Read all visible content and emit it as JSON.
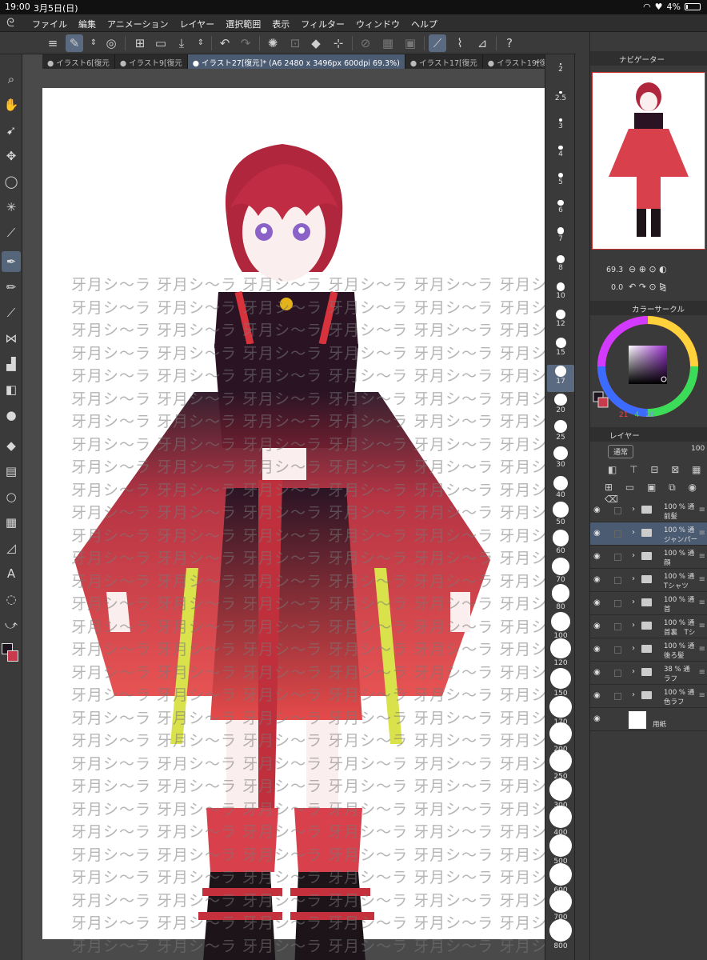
{
  "status": {
    "time": "19:00",
    "date": "3月5日(日)",
    "battery": "4%"
  },
  "menu": {
    "items": [
      "ファイル",
      "編集",
      "アニメーション",
      "レイヤー",
      "選択範囲",
      "表示",
      "フィルター",
      "ウィンドウ",
      "ヘルプ"
    ]
  },
  "tabs": [
    {
      "label": "● イラスト6[復元"
    },
    {
      "label": "● イラスト9[復元"
    },
    {
      "label": "● イラスト27[復元]* (A6 2480 x 3496px 600dpi 69.3%)"
    },
    {
      "label": "● イラスト17[復元"
    },
    {
      "label": "● イラスト19[復元"
    }
  ],
  "watermark": {
    "text": "牙月シ〜ラ"
  },
  "brush_sizes": [
    "2",
    "2.5",
    "3",
    "4",
    "5",
    "6",
    "7",
    "8",
    "10",
    "12",
    "15",
    "17",
    "20",
    "25",
    "30",
    "40",
    "50",
    "60",
    "70",
    "80",
    "100",
    "120",
    "150",
    "170",
    "200",
    "250",
    "300",
    "400",
    "500",
    "600",
    "700",
    "800"
  ],
  "navigator": {
    "title": "ナビゲーター",
    "zoom": "69.3",
    "rotation": "0.0"
  },
  "color": {
    "title": "カラーサークル",
    "r": "21",
    "g": "4",
    "b": "26"
  },
  "layers": {
    "title": "レイヤー",
    "blend": "通常",
    "opacity": "100",
    "items": [
      {
        "pct": "100 % 通",
        "name": "前髪"
      },
      {
        "pct": "100 % 通",
        "name": "ジャンパー"
      },
      {
        "pct": "100 % 通",
        "name": "顔"
      },
      {
        "pct": "100 % 通",
        "name": "Tシャツ"
      },
      {
        "pct": "100 % 通",
        "name": "首"
      },
      {
        "pct": "100 % 通",
        "name": "首裏　Tシ"
      },
      {
        "pct": "100 % 通",
        "name": "後ろ髪"
      },
      {
        "pct": "38 % 通",
        "name": "ラフ"
      },
      {
        "pct": "100 % 通",
        "name": "色ラフ"
      },
      {
        "pct": "",
        "name": "用紙"
      }
    ]
  },
  "colors": {
    "accent": "#4b5b72",
    "main_color": "#1d1420",
    "sub_color": "#c83a4c"
  }
}
